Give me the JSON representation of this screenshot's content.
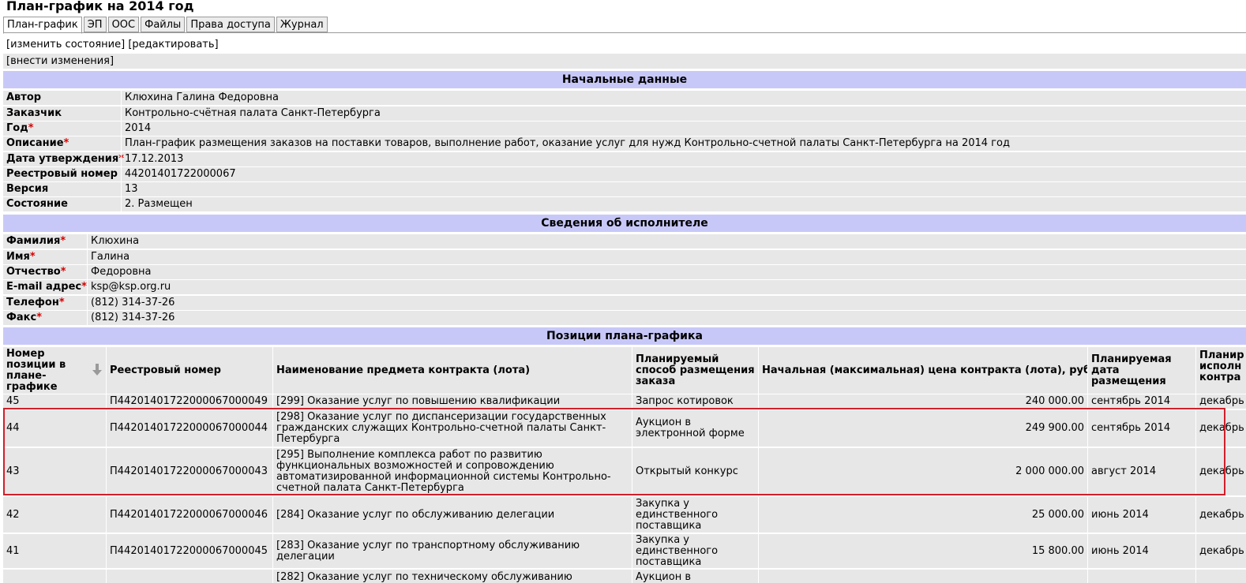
{
  "page_title": "План-график на 2014 год",
  "tabs": [
    {
      "label": "План-график",
      "active": true
    },
    {
      "label": "ЭП"
    },
    {
      "label": "ООС"
    },
    {
      "label": "Файлы"
    },
    {
      "label": "Права доступа"
    },
    {
      "label": "Журнал"
    }
  ],
  "actions": {
    "change_state": "[изменить состояние]",
    "edit": "[редактировать]",
    "make_changes": "[внести изменения]"
  },
  "initial_data": {
    "header": "Начальные данные",
    "rows": [
      {
        "label": "Автор",
        "value": "Клюхина Галина Федоровна",
        "required": ""
      },
      {
        "label": "Заказчик",
        "value": "Контрольно-счётная палата Санкт-Петербурга",
        "required": ""
      },
      {
        "label": "Год",
        "value": "2014",
        "required": "*"
      },
      {
        "label": "Описание",
        "value": "План-график размещения заказов на поставки товаров, выполнение работ, оказание услуг для нужд Контрольно-счетной палаты Санкт-Петербурга на 2014 год",
        "required": "*"
      },
      {
        "label": "Дата утверждения",
        "value": "17.12.2013",
        "required": "*"
      },
      {
        "label": "Реестровый номер",
        "value": "44201401722000067",
        "required": ""
      },
      {
        "label": "Версия",
        "value": "13",
        "required": ""
      },
      {
        "label": "Состояние",
        "value": "2. Размещен",
        "required": ""
      }
    ]
  },
  "executor": {
    "header": "Сведения об исполнителе",
    "rows": [
      {
        "label": "Фамилия",
        "value": "Клюхина",
        "required": "*"
      },
      {
        "label": "Имя",
        "value": "Галина",
        "required": "*"
      },
      {
        "label": "Отчество",
        "value": "Федоровна",
        "required": "*"
      },
      {
        "label": "E-mail адрес",
        "value": "ksp@ksp.org.ru",
        "required": "*"
      },
      {
        "label": "Телефон",
        "value": "(812) 314-37-26",
        "required": "*"
      },
      {
        "label": "Факс",
        "value": "(812) 314-37-26",
        "required": "*"
      }
    ]
  },
  "positions": {
    "header": "Позиции плана-графика",
    "columns": [
      "Номер позиции в плане-графике",
      "Реестровый номер",
      "Наименование предмета контракта (лота)",
      "Планируемый способ размещения заказа",
      "Начальная (максимальная) цена контракта (лота), руб.",
      "Планируемая дата размещения",
      "Планир исполн контра"
    ],
    "rows": [
      {
        "num": "45",
        "reg": "П44201401722000067000049",
        "name": "[299] Оказание услуг по повышению квалификации",
        "method": "Запрос котировок",
        "price": "240 000.00",
        "date": "сентябрь 2014",
        "exec": "декабрь"
      },
      {
        "num": "44",
        "reg": "П44201401722000067000044",
        "name": "[298] Оказание услуг по диспансеризации государственных гражданских служащих Контрольно-счетной палаты Санкт-Петербурга",
        "method": "Аукцион в электронной форме",
        "price": "249 900.00",
        "date": "сентябрь 2014",
        "exec": "декабрь"
      },
      {
        "num": "43",
        "reg": "П44201401722000067000043",
        "name": "[295] Выполнение комплекса работ по развитию функциональных возможностей и сопровождению автоматизированной информационной системы Контрольно-счетной палата Санкт-Петербурга",
        "method": "Открытый конкурс",
        "price": "2 000 000.00",
        "date": "август 2014",
        "exec": "декабрь"
      },
      {
        "num": "42",
        "reg": "П44201401722000067000046",
        "name": "[284] Оказание услуг по обслуживанию делегации",
        "method": "Закупка у единственного поставщика",
        "price": "25 000.00",
        "date": "июнь 2014",
        "exec": "декабрь"
      },
      {
        "num": "41",
        "reg": "П44201401722000067000045",
        "name": "[283] Оказание услуг по транспортному обслуживанию делегации",
        "method": "Закупка у единственного поставщика",
        "price": "15 800.00",
        "date": "июнь 2014",
        "exec": "декабрь"
      },
      {
        "num": "",
        "reg": "",
        "name": "[282] Оказание услуг по техническому обслуживанию",
        "method": "Аукцион в",
        "price": "",
        "date": "",
        "exec": ""
      }
    ]
  },
  "colors": {
    "section_header_bg": "#c8c8f8",
    "row_bg": "#e7e7e7",
    "required_mark": "#d40000",
    "highlight_border": "#d0202a"
  },
  "icons": {
    "sort": "sort-down-arrow-icon"
  }
}
